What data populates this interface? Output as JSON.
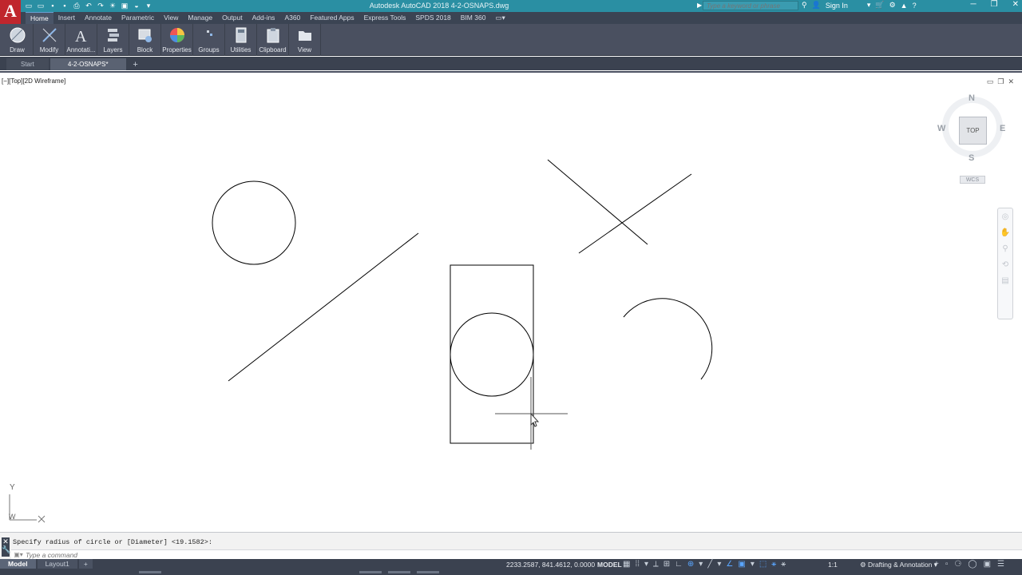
{
  "app": {
    "window_title": "Autodesk AutoCAD 2018    4-2-OSNAPS.dwg",
    "logo_letter": "A",
    "search_placeholder": "Type a keyword or phrase",
    "sign_in": "Sign In",
    "accent_color": "#2a8fa3",
    "logo_color": "#c0262d"
  },
  "ribbon": {
    "tabs": [
      {
        "label": "Home",
        "active": true
      },
      {
        "label": "Insert"
      },
      {
        "label": "Annotate"
      },
      {
        "label": "Parametric"
      },
      {
        "label": "View"
      },
      {
        "label": "Manage"
      },
      {
        "label": "Output"
      },
      {
        "label": "Add-ins"
      },
      {
        "label": "A360"
      },
      {
        "label": "Featured Apps"
      },
      {
        "label": "Express Tools"
      },
      {
        "label": "SPDS 2018"
      },
      {
        "label": "BIM 360"
      }
    ],
    "panels": [
      {
        "label": "Draw",
        "icon": "draw-icon"
      },
      {
        "label": "Modify",
        "icon": "modify-icon"
      },
      {
        "label": "Annotati...",
        "icon": "annotation-icon"
      },
      {
        "label": "Layers",
        "icon": "layers-icon"
      },
      {
        "label": "Block",
        "icon": "block-icon"
      },
      {
        "label": "Properties",
        "icon": "properties-icon"
      },
      {
        "label": "Groups",
        "icon": "groups-icon"
      },
      {
        "label": "Utilities",
        "icon": "utilities-icon"
      },
      {
        "label": "Clipboard",
        "icon": "clipboard-icon"
      },
      {
        "label": "View",
        "icon": "view-icon"
      }
    ]
  },
  "doc_tabs": [
    {
      "label": "Start"
    },
    {
      "label": "4-2-OSNAPS*",
      "active": true
    }
  ],
  "viewport": {
    "label": "[−][Top][2D Wireframe]",
    "viewcube": {
      "top": "TOP",
      "n": "N",
      "s": "S",
      "e": "E",
      "w": "W",
      "wcs": "WCS"
    }
  },
  "ucs": {
    "y": "Y",
    "w": "W"
  },
  "command_line": {
    "history": "Specify radius of circle or [Diameter] <19.1582>:",
    "placeholder": "Type a command"
  },
  "status_bar": {
    "layout_tabs": [
      {
        "label": "Model",
        "active": true
      },
      {
        "label": "Layout1"
      }
    ],
    "coordinates": "2233.2587, 841.4612, 0.0000",
    "space": "MODEL",
    "scale": "1:1",
    "workspace": "Drafting & Annotation"
  }
}
